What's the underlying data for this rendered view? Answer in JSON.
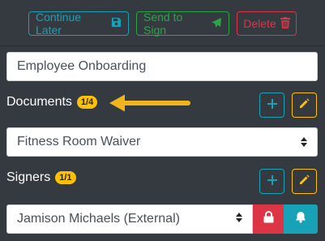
{
  "toolbar": {
    "continue_label": "Continue Later",
    "send_label": "Send to Sign",
    "delete_label": "Delete"
  },
  "template": {
    "name_value": "Employee Onboarding"
  },
  "documents": {
    "label": "Documents",
    "badge": "1/4",
    "selected": "Fitness Room Waiver"
  },
  "signers": {
    "label": "Signers",
    "badge": "1/1",
    "selected": "Jamison Michaels (External)"
  },
  "colors": {
    "info": "#17a2b8",
    "success": "#28a745",
    "danger": "#dc3545",
    "warning": "#ffc107",
    "background": "#343a40"
  },
  "icons": {
    "save": "floppy-disk-icon",
    "send": "paper-plane-icon",
    "delete": "trash-icon",
    "add": "plus-icon",
    "edit": "pencil-icon",
    "lock": "lock-icon",
    "bell": "bell-icon",
    "select": "sort-caret-icon",
    "annotation": "arrow-left-icon"
  }
}
